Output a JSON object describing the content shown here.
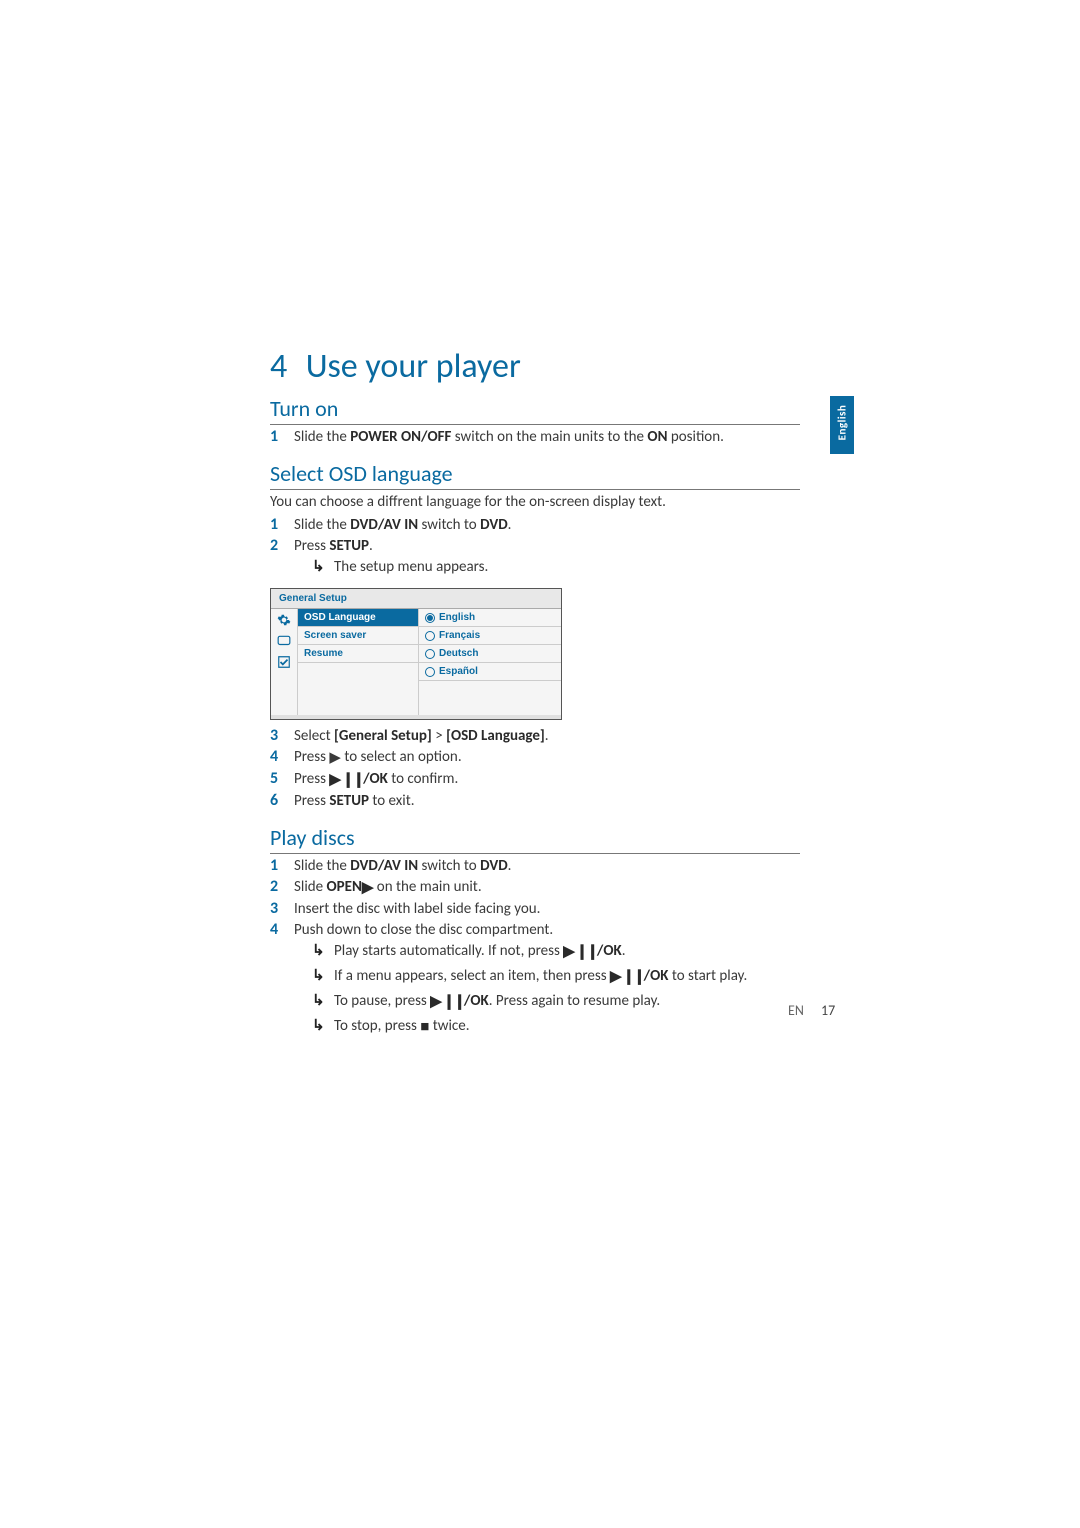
{
  "lang_tab": "English",
  "chapter": {
    "num": "4",
    "title": "Use your player"
  },
  "s1": {
    "heading": "Turn on",
    "step1_pre": "Slide the ",
    "step1_bold": "POWER ON/OFF",
    "step1_mid": " switch on the main units to the ",
    "step1_bold2": "ON",
    "step1_post": " position."
  },
  "s2": {
    "heading": "Select OSD language",
    "intro": "You can choose a diffrent language for the on-screen display text.",
    "step1_pre": "Slide the ",
    "step1_bold": "DVD/AV IN",
    "step1_mid": " switch to ",
    "step1_bold2": "DVD",
    "step1_post": ".",
    "step2_pre": "Press ",
    "step2_bold": "SETUP",
    "step2_post": ".",
    "step2_sub": "The setup menu appears.",
    "step3_pre": "Select ",
    "step3_bold": "[General Setup]",
    "step3_mid": " > ",
    "step3_bold2": "[OSD Language]",
    "step3_post": ".",
    "step4_pre": "Press ",
    "step4_post": " to select an option.",
    "step5_pre": "Press ",
    "step5_bold_after_icon": "/OK",
    "step5_post": " to confirm.",
    "step6_pre": "Press ",
    "step6_bold": "SETUP",
    "step6_post": " to exit."
  },
  "osd": {
    "header": "General Setup",
    "left": [
      "OSD Language",
      "Screen saver",
      "Resume"
    ],
    "opts": [
      "English",
      "Français",
      "Deutsch",
      "Español"
    ],
    "selected": "English"
  },
  "s3": {
    "heading": "Play discs",
    "step1_pre": "Slide the ",
    "step1_bold": "DVD/AV IN",
    "step1_mid": " switch to ",
    "step1_bold2": "DVD",
    "step1_post": ".",
    "step2_pre": "Slide ",
    "step2_bold": "OPEN",
    "step2_post": " on the main unit.",
    "step3": "Insert the disc with label side facing you.",
    "step4": "Push down to close the disc compartment.",
    "sub1_pre": "Play starts automatically. If not, press ",
    "sub1_bold_after_icon": "/OK",
    "sub1_post": ".",
    "sub2_pre": "If a menu appears, select an item, then press ",
    "sub2_bold_after_icon": "/OK",
    "sub2_post": " to start play.",
    "sub3_pre": "To pause, press ",
    "sub3_bold_after_icon": "/OK",
    "sub3_post": ". Press again to resume play.",
    "sub4_pre": "To stop, press ",
    "sub4_post": " twice."
  },
  "footer": {
    "lang": "EN",
    "page": "17"
  }
}
